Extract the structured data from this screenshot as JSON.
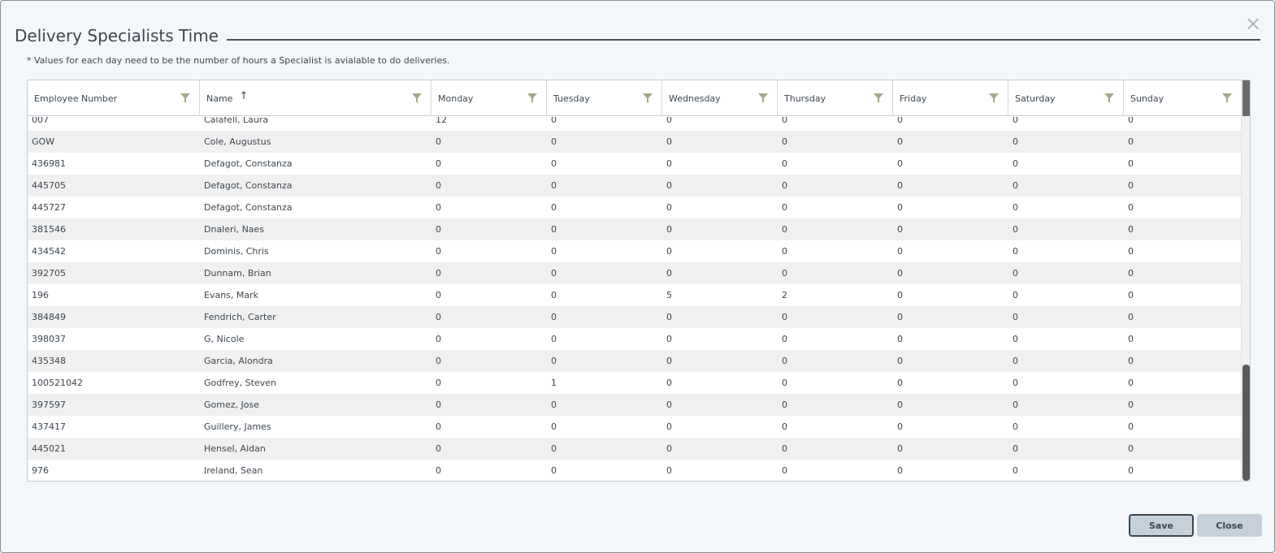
{
  "dialog": {
    "title": "Delivery Specialists Time",
    "note": "* Values for each day need to be the number of hours a Specialist is avialable to do deliveries.",
    "close_icon": "×"
  },
  "grid": {
    "columns": [
      "Employee Number",
      "Name",
      "Monday",
      "Tuesday",
      "Wednesday",
      "Thursday",
      "Friday",
      "Saturday",
      "Sunday"
    ],
    "sort_indicator": "↑",
    "rows": [
      [
        "007",
        "Calafell, Laura",
        "12",
        "0",
        "0",
        "0",
        "0",
        "0",
        "0"
      ],
      [
        "GOW",
        "Cole, Augustus",
        "0",
        "0",
        "0",
        "0",
        "0",
        "0",
        "0"
      ],
      [
        "436981",
        "Defagot, Constanza",
        "0",
        "0",
        "0",
        "0",
        "0",
        "0",
        "0"
      ],
      [
        "445705",
        "Defagot, Constanza",
        "0",
        "0",
        "0",
        "0",
        "0",
        "0",
        "0"
      ],
      [
        "445727",
        "Defagot, Constanza",
        "0",
        "0",
        "0",
        "0",
        "0",
        "0",
        "0"
      ],
      [
        "381546",
        "Dnaleri, Naes",
        "0",
        "0",
        "0",
        "0",
        "0",
        "0",
        "0"
      ],
      [
        "434542",
        "Dominis, Chris",
        "0",
        "0",
        "0",
        "0",
        "0",
        "0",
        "0"
      ],
      [
        "392705",
        "Dunnam, Brian",
        "0",
        "0",
        "0",
        "0",
        "0",
        "0",
        "0"
      ],
      [
        "196",
        "Evans, Mark",
        "0",
        "0",
        "5",
        "2",
        "0",
        "0",
        "0"
      ],
      [
        "384849",
        "Fendrich, Carter",
        "0",
        "0",
        "0",
        "0",
        "0",
        "0",
        "0"
      ],
      [
        "398037",
        "G, Nicole",
        "0",
        "0",
        "0",
        "0",
        "0",
        "0",
        "0"
      ],
      [
        "435348",
        "Garcia, Alondra",
        "0",
        "0",
        "0",
        "0",
        "0",
        "0",
        "0"
      ],
      [
        "100521042",
        "Godfrey, Steven",
        "0",
        "1",
        "0",
        "0",
        "0",
        "0",
        "0"
      ],
      [
        "397597",
        "Gomez, Jose",
        "0",
        "0",
        "0",
        "0",
        "0",
        "0",
        "0"
      ],
      [
        "437417",
        "Guillery, James",
        "0",
        "0",
        "0",
        "0",
        "0",
        "0",
        "0"
      ],
      [
        "445021",
        "Hensel, Aidan",
        "0",
        "0",
        "0",
        "0",
        "0",
        "0",
        "0"
      ],
      [
        "976",
        "Ireland, Sean",
        "0",
        "0",
        "0",
        "0",
        "0",
        "0",
        "0"
      ]
    ]
  },
  "buttons": {
    "save_label": "Save",
    "close_label": "Close"
  },
  "colors": {
    "filter_icon": "#a3a98a",
    "button_bg": "#c5d0da"
  }
}
